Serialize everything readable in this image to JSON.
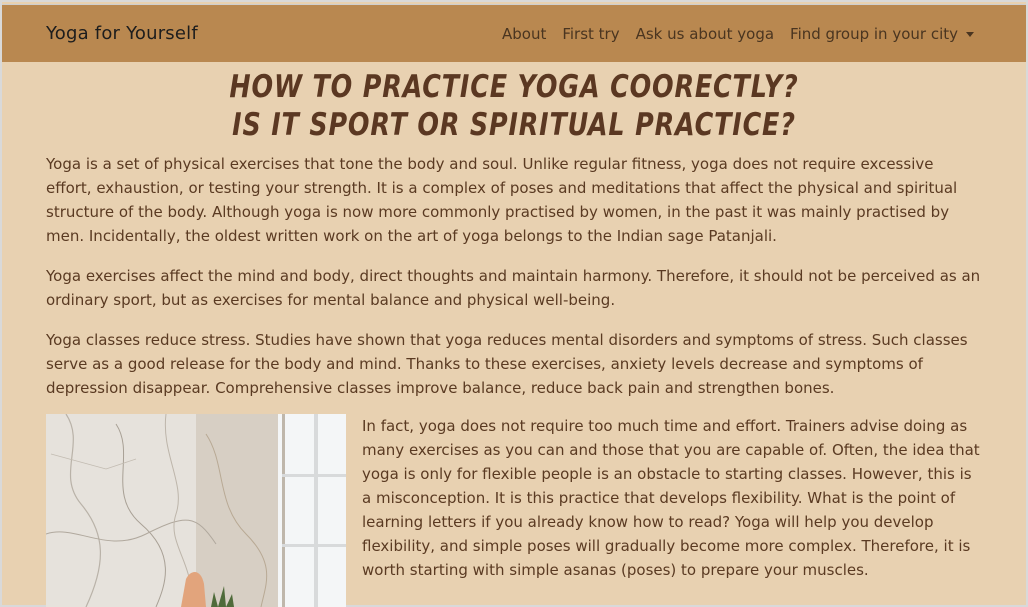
{
  "navbar": {
    "brand": "Yoga for Yourself",
    "items": [
      {
        "label": "About"
      },
      {
        "label": "First try"
      },
      {
        "label": "Ask us about yoga"
      },
      {
        "label": "Find group in your city"
      }
    ]
  },
  "heading": {
    "line1": "HOW TO PRACTICE YOGA COORECTLY?",
    "line2": "IS IT SPORT OR SPIRITUAL PRACTICE?"
  },
  "paragraphs": [
    "Yoga is a set of physical exercises that tone the body and soul. Unlike regular fitness, yoga does not require excessive effort, exhaustion, or testing your strength. It is a complex of poses and meditations that affect the physical and spiritual structure of the body. Although yoga is now more commonly practised by women, in the past it was mainly practised by men. Incidentally, the oldest written work on the art of yoga belongs to the Indian sage Patanjali.",
    "Yoga exercises affect the mind and body, direct thoughts and maintain harmony. Therefore, it should not be perceived as an ordinary sport, but as exercises for mental balance and physical well-being.",
    "Yoga classes reduce stress. Studies have shown that yoga reduces mental disorders and symptoms of stress. Such classes serve as a good release for the body and mind. Thanks to these exercises, anxiety levels decrease and symptoms of depression disappear. Comprehensive classes improve balance, reduce back pain and strengthen bones."
  ],
  "side_paragraph": "In fact, yoga does not require too much time and effort. Trainers advise doing as many exercises as you can and those that you are capable of. Often, the idea that yoga is only for flexible people is an obstacle to starting classes. However, this is a misconception. It is this practice that develops flexibility. What is the point of learning letters if you already know how to read? Yoga will help you develop flexibility, and simple poses will gradually become more complex. Therefore, it is worth starting with simple asanas (poses) to prepare your muscles."
}
